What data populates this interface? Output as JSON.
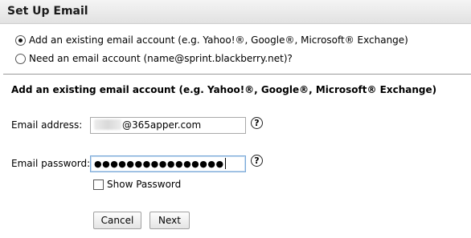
{
  "header": {
    "title": "Set Up Email"
  },
  "account_type": {
    "options": [
      {
        "label": "Add an existing email account (e.g. Yahoo!®, Google®, Microsoft® Exchange)",
        "selected": true
      },
      {
        "label": "Need an email account (name@sprint.blackberry.net)?",
        "selected": false
      }
    ]
  },
  "form": {
    "heading": "Add an existing email account (e.g. Yahoo!®, Google®, Microsoft® Exchange)",
    "email": {
      "label": "Email address:",
      "value": "@365apper.com"
    },
    "password": {
      "label": "Email password:",
      "masked_value": "●●●●●●●●●●●●●●●●"
    },
    "help_glyph": "?",
    "show_password": {
      "label": "Show Password",
      "checked": false
    }
  },
  "buttons": {
    "cancel": "Cancel",
    "next": "Next"
  }
}
